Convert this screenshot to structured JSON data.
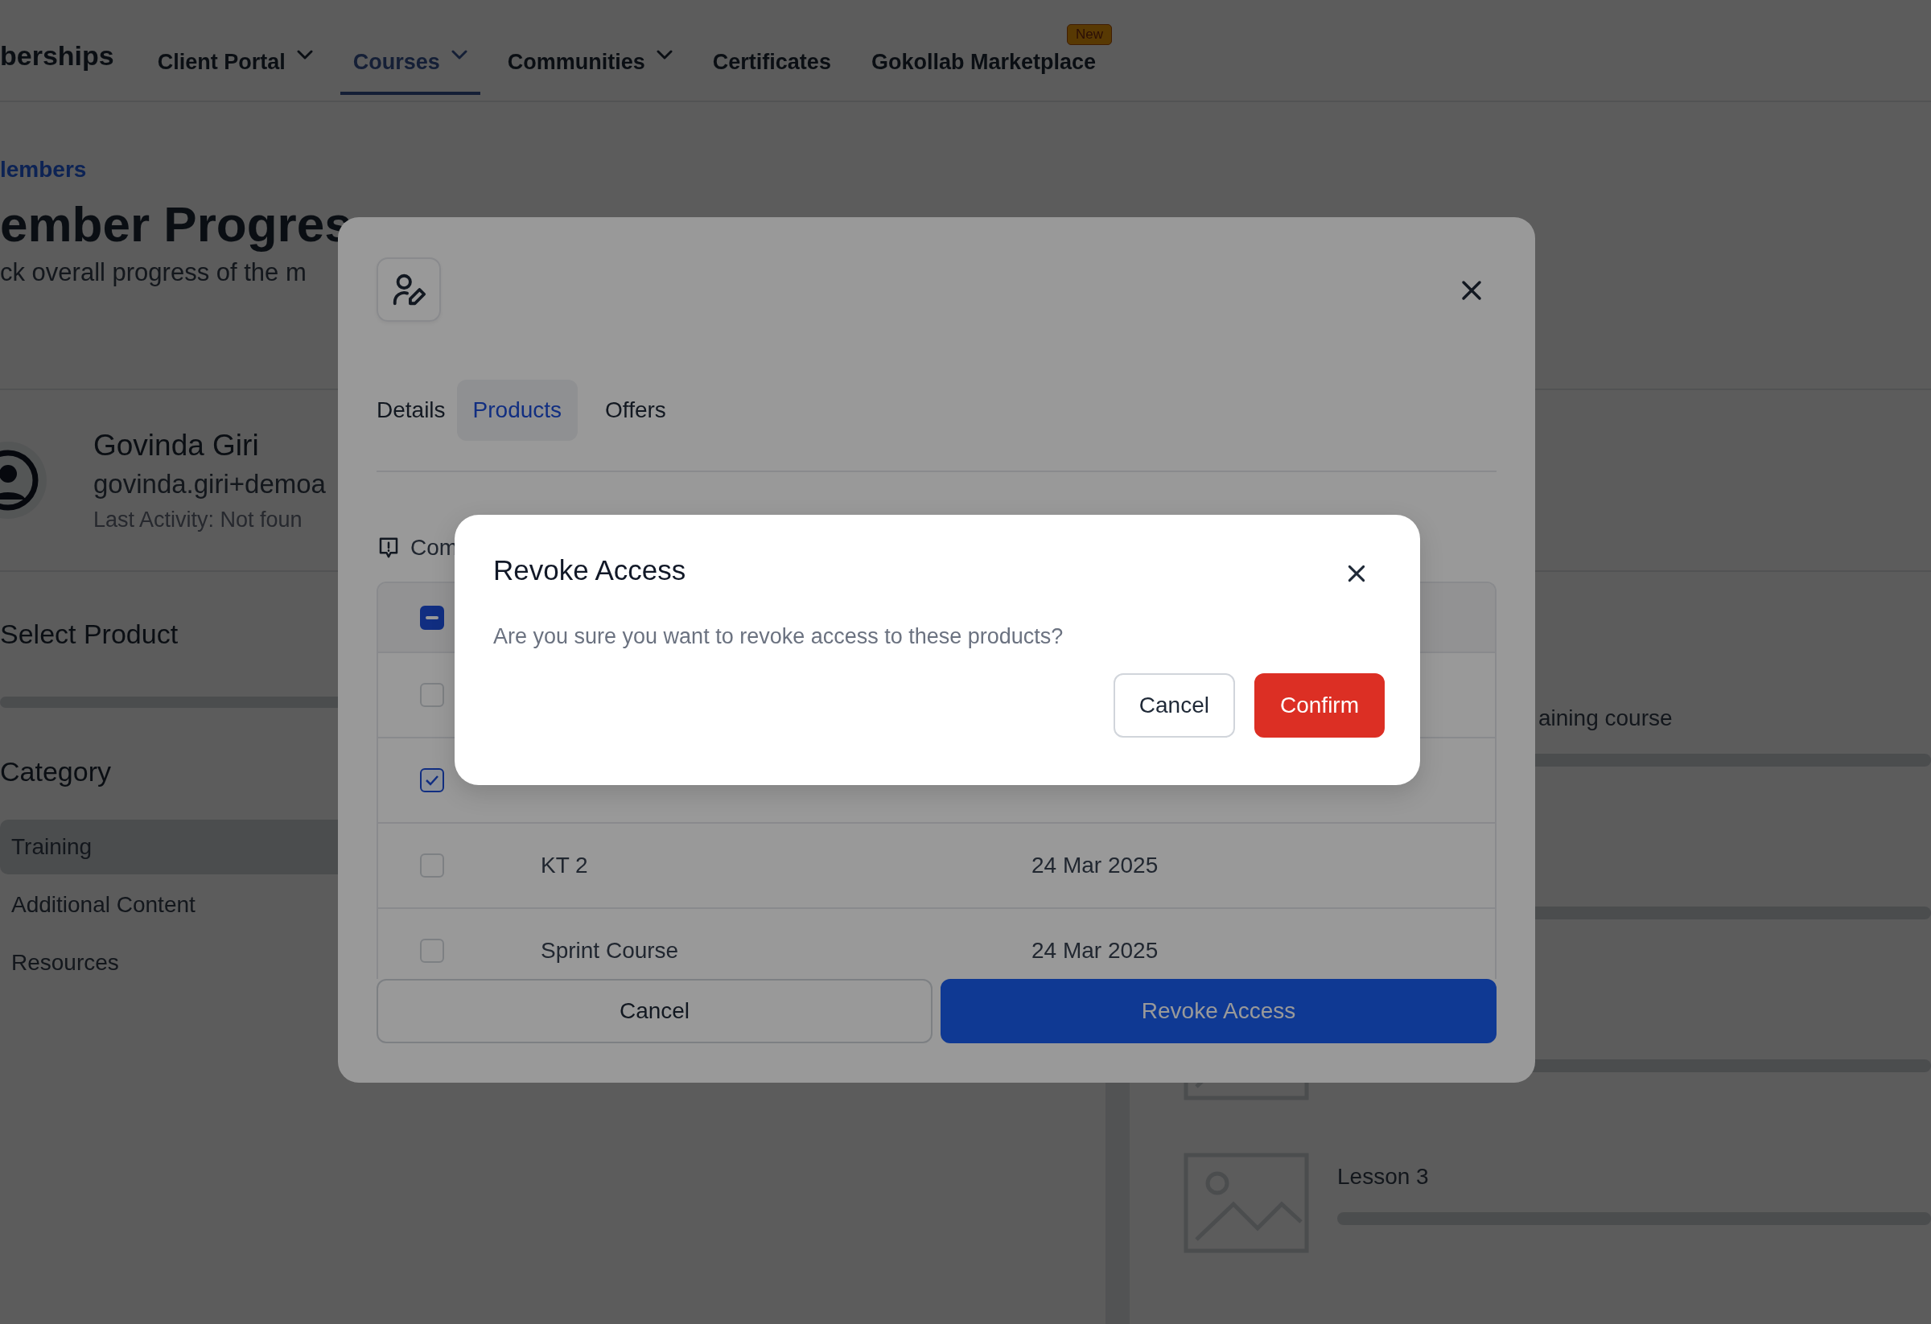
{
  "nav": {
    "brand": "berships",
    "items": [
      {
        "label": "Client Portal",
        "has_dropdown": true,
        "selected": false
      },
      {
        "label": "Courses",
        "has_dropdown": true,
        "selected": true
      },
      {
        "label": "Communities",
        "has_dropdown": true,
        "selected": false
      },
      {
        "label": "Certificates",
        "has_dropdown": false,
        "selected": false
      },
      {
        "label": "Gokollab Marketplace",
        "has_dropdown": false,
        "selected": false,
        "badge": "New"
      }
    ]
  },
  "breadcrumb": "lembers",
  "page_title": "ember Progres",
  "page_subtitle": "ck overall progress of the m",
  "member": {
    "name": "Govinda Giri",
    "email": "govinda.giri+demoa",
    "last_activity": "Last Activity: Not foun"
  },
  "select_product_label": "Select Product",
  "category_label": "Category",
  "categories": [
    {
      "label": "Training",
      "selected": true
    },
    {
      "label": "Additional Content",
      "selected": false
    },
    {
      "label": "Resources",
      "selected": false
    }
  ],
  "lessons": [
    {
      "title": "aining course"
    },
    {
      "title": "Lesson 3"
    }
  ],
  "modal": {
    "tabs": [
      {
        "label": "Details",
        "selected": false
      },
      {
        "label": "Products",
        "selected": true
      },
      {
        "label": "Offers",
        "selected": false
      }
    ],
    "notice": "Com",
    "table": {
      "header": {
        "indeterminate": true
      },
      "rows": [
        {
          "checked": false
        },
        {
          "checked": true
        },
        {
          "checked": false,
          "name": "KT 2",
          "date": "24 Mar 2025"
        },
        {
          "checked": false,
          "name": "Sprint Course",
          "date": "24 Mar 2025"
        }
      ]
    },
    "buttons": [
      {
        "label": "Cancel",
        "kind": "secondary"
      },
      {
        "label": "Revoke Access",
        "kind": "primary"
      }
    ]
  },
  "dialog": {
    "title": "Revoke Access",
    "message": "Are you sure you want to revoke access to these products?",
    "buttons": [
      {
        "label": "Cancel",
        "kind": "secondary"
      },
      {
        "label": "Confirm",
        "kind": "danger"
      }
    ]
  }
}
